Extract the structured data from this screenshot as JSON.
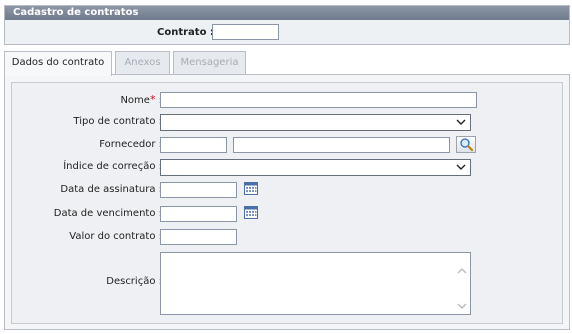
{
  "panel": {
    "title": "Cadastro de contratos"
  },
  "contract": {
    "label": "Contrato :",
    "value": ""
  },
  "tabs": [
    {
      "label": "Dados do contrato",
      "active": true
    },
    {
      "label": "Anexos",
      "active": false
    },
    {
      "label": "Mensageria",
      "active": false
    }
  ],
  "form": {
    "nome": {
      "label": "Nome",
      "required_mark": "*",
      "separator": ":",
      "value": ""
    },
    "tipo": {
      "label": "Tipo de contrato :",
      "value": ""
    },
    "fornecedor": {
      "label": "Fornecedor :",
      "code": "",
      "name": ""
    },
    "indice": {
      "label": "Índice de correção :",
      "value": ""
    },
    "assinatura": {
      "label": "Data de assinatura :",
      "value": ""
    },
    "vencimento": {
      "label": "Data de vencimento :",
      "value": ""
    },
    "valor": {
      "label": "Valor do contrato :",
      "value": ""
    },
    "descricao": {
      "label": "Descrição :",
      "value": ""
    }
  },
  "icons": {
    "search": "magnifier-icon",
    "calendar": "calendar-icon",
    "dropdown": "chevron-down-icon"
  },
  "colors": {
    "header_bg": "#7a8597",
    "required": "#c0141c",
    "panel_bg": "#eef1f4"
  }
}
